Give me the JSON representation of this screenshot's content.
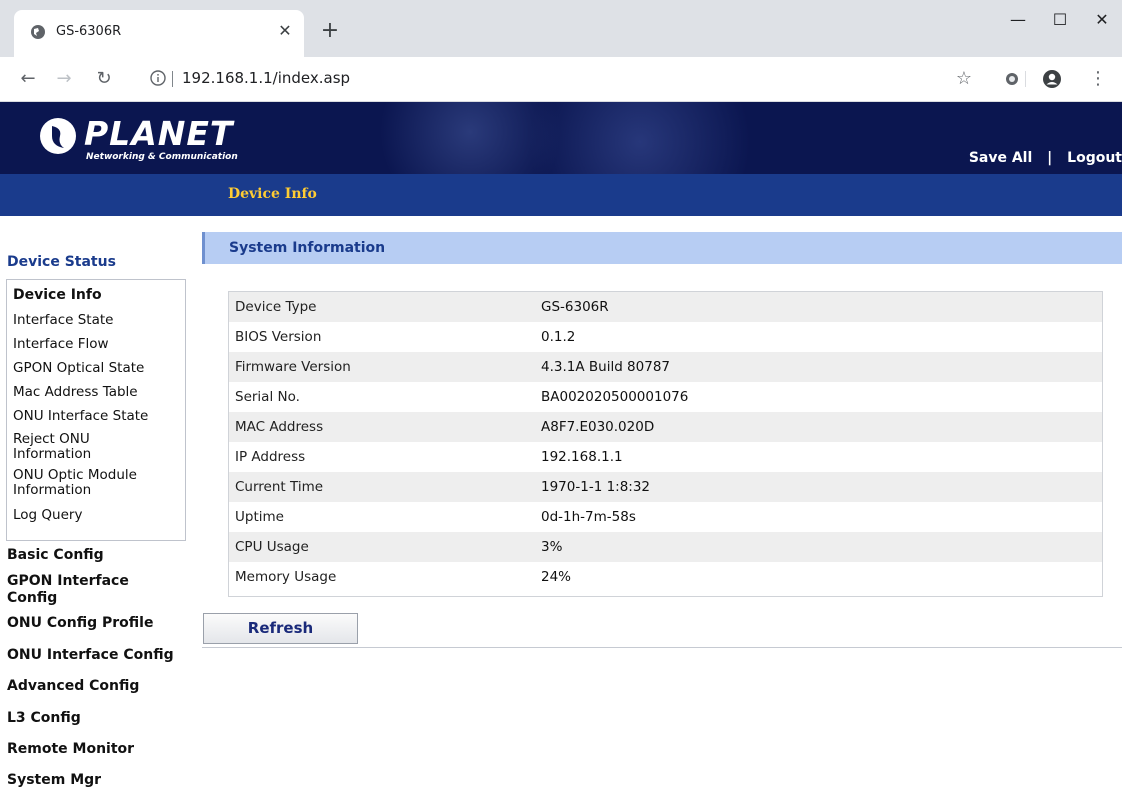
{
  "browser": {
    "tab_title": "GS-6306R",
    "url": "192.168.1.1/index.asp"
  },
  "header": {
    "logo_text": "PLANET",
    "logo_sub": "Networking & Communication",
    "save_all": "Save All",
    "separator": "|",
    "logout": "Logout",
    "current_page": "Device Info"
  },
  "sidebar": {
    "heading": "Device Status",
    "items": [
      {
        "label": "Device Info"
      },
      {
        "label": "Interface State"
      },
      {
        "label": "Interface Flow"
      },
      {
        "label": "GPON Optical State"
      },
      {
        "label": "Mac Address Table"
      },
      {
        "label": "ONU Interface State"
      },
      {
        "label": "Reject ONU Information"
      },
      {
        "label": "ONU Optic Module Information"
      },
      {
        "label": "Log Query"
      }
    ],
    "categories": [
      {
        "label": "Basic Config"
      },
      {
        "label": "GPON Interface Config"
      },
      {
        "label": "ONU Config Profile"
      },
      {
        "label": "ONU Interface Config"
      },
      {
        "label": "Advanced Config"
      },
      {
        "label": "L3 Config"
      },
      {
        "label": "Remote Monitor"
      },
      {
        "label": "System Mgr"
      }
    ]
  },
  "main": {
    "section_title": "System Information",
    "rows": [
      {
        "key": "Device Type",
        "value": "GS-6306R"
      },
      {
        "key": "BIOS Version",
        "value": "0.1.2"
      },
      {
        "key": "Firmware Version",
        "value": "4.3.1A Build 80787"
      },
      {
        "key": "Serial No.",
        "value": "BA002020500001076"
      },
      {
        "key": "MAC Address",
        "value": "A8F7.E030.020D"
      },
      {
        "key": "IP Address",
        "value": "192.168.1.1"
      },
      {
        "key": "Current Time",
        "value": "1970-1-1 1:8:32"
      },
      {
        "key": "Uptime",
        "value": "0d-1h-7m-58s"
      },
      {
        "key": "CPU Usage",
        "value": "3%"
      },
      {
        "key": "Memory Usage",
        "value": "24%"
      }
    ],
    "refresh_label": "Refresh"
  },
  "colors": {
    "banner": "#0b1650",
    "nav_strip": "#1a3b8c",
    "nav_current": "#ffcc33",
    "section_bar": "#b7cdf3",
    "row_alt": "#eeeeee"
  }
}
